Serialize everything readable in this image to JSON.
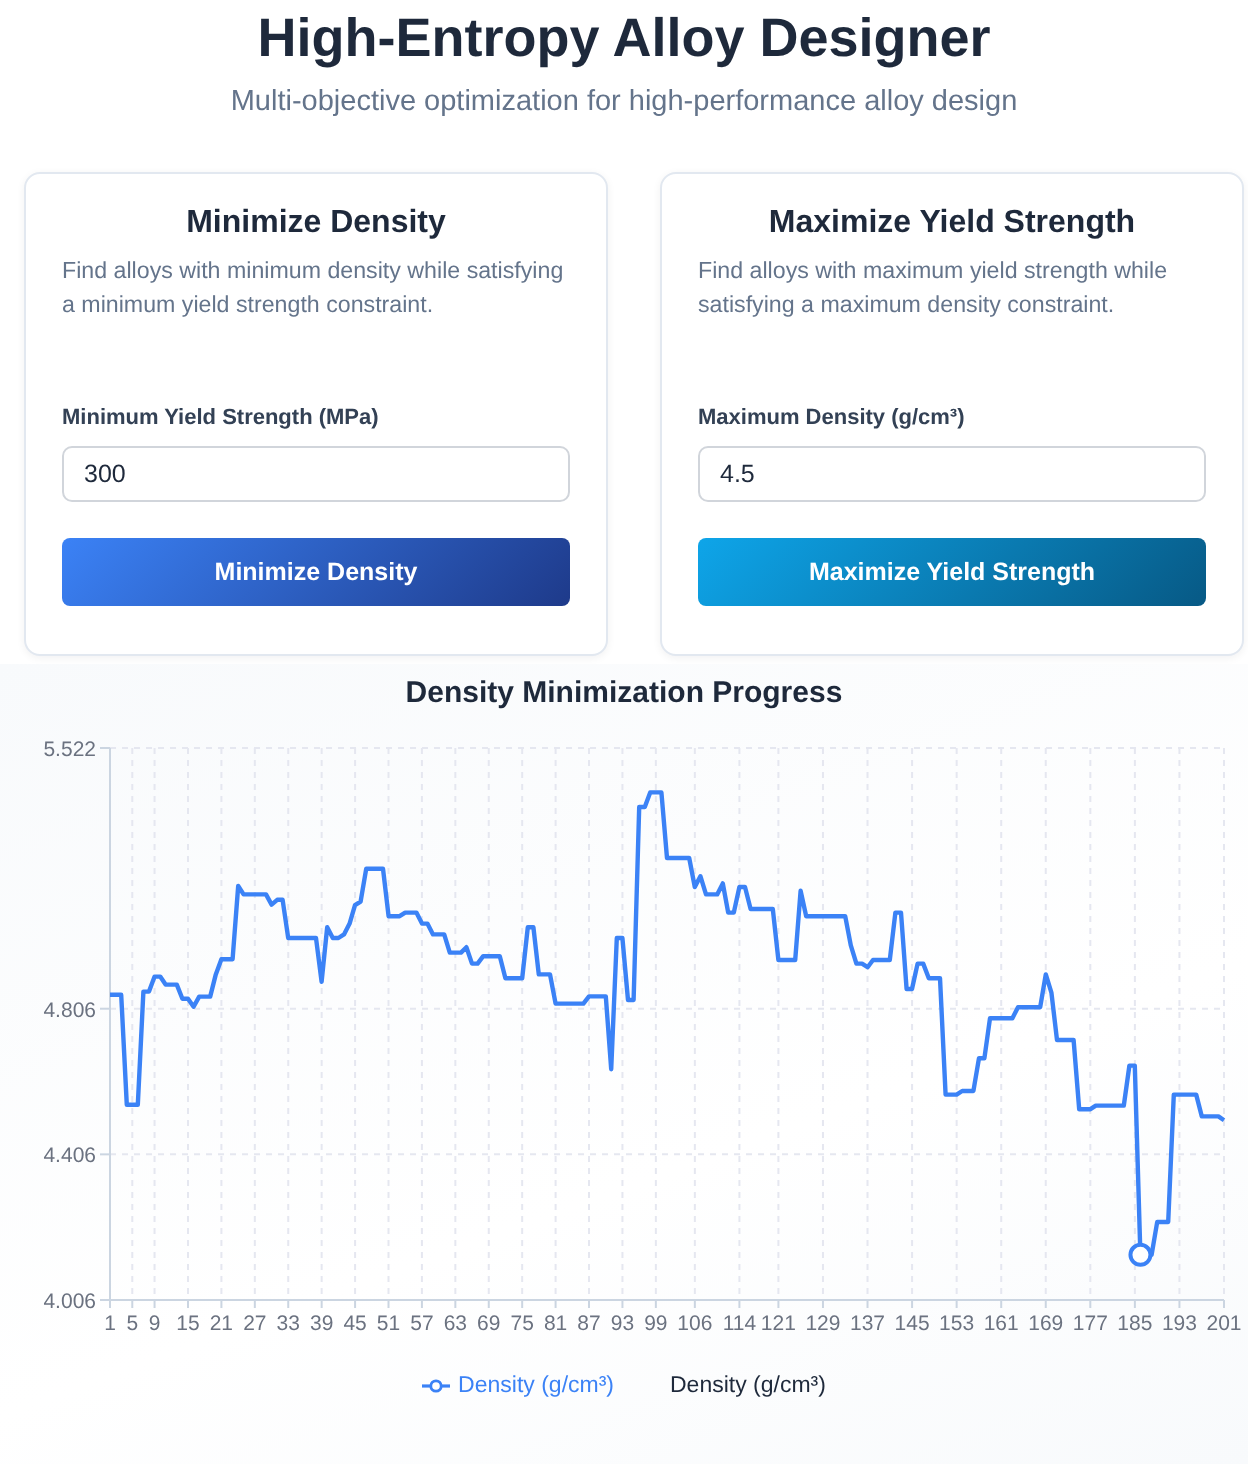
{
  "header": {
    "title": "High-Entropy Alloy Designer",
    "subtitle": "Multi-objective optimization for high-performance alloy design"
  },
  "cards": [
    {
      "title": "Minimize Density",
      "description": "Find alloys with minimum density while satisfying a minimum yield strength constraint.",
      "field_label": "Minimum Yield Strength (MPa)",
      "value": "300",
      "button": "Minimize Density",
      "kind": "blue"
    },
    {
      "title": "Maximize Yield Strength",
      "description": "Find alloys with maximum yield strength while satisfying a maximum density constraint.",
      "field_label": "Maximum Density (g/cm³)",
      "value": "4.5",
      "button": "Maximize Yield Strength",
      "kind": "cyan"
    }
  ],
  "chart": {
    "title": "Density Minimization Progress",
    "chart_data": {
      "type": "line",
      "ylabel": "Density (g/cm³)",
      "grid": true,
      "xlim": [
        1,
        201
      ],
      "ylim": [
        4.006,
        5.522
      ],
      "x": [
        1,
        2,
        3,
        4,
        5,
        6,
        7,
        8,
        9,
        10,
        11,
        12,
        13,
        14,
        15,
        16,
        17,
        18,
        19,
        20,
        21,
        22,
        23,
        24,
        25,
        26,
        27,
        28,
        29,
        30,
        31,
        32,
        33,
        34,
        35,
        36,
        37,
        38,
        39,
        40,
        41,
        42,
        43,
        44,
        45,
        46,
        47,
        48,
        49,
        50,
        51,
        52,
        53,
        54,
        55,
        56,
        57,
        58,
        59,
        60,
        61,
        62,
        63,
        64,
        65,
        66,
        67,
        68,
        69,
        70,
        71,
        72,
        73,
        74,
        75,
        76,
        77,
        78,
        79,
        80,
        81,
        82,
        83,
        84,
        85,
        86,
        87,
        88,
        89,
        90,
        91,
        92,
        93,
        94,
        95,
        96,
        97,
        98,
        99,
        100,
        101,
        102,
        103,
        104,
        105,
        106,
        107,
        108,
        109,
        110,
        111,
        112,
        113,
        114,
        115,
        116,
        117,
        118,
        119,
        120,
        121,
        122,
        123,
        124,
        125,
        126,
        127,
        128,
        129,
        130,
        131,
        132,
        133,
        134,
        135,
        136,
        137,
        138,
        139,
        140,
        141,
        142,
        143,
        144,
        145,
        146,
        147,
        148,
        149,
        150,
        151,
        152,
        153,
        154,
        155,
        156,
        157,
        158,
        159,
        160,
        161,
        162,
        163,
        164,
        165,
        166,
        167,
        168,
        169,
        170,
        171,
        172,
        173,
        174,
        175,
        176,
        177,
        178,
        179,
        180,
        181,
        182,
        183,
        184,
        185,
        186,
        187,
        188,
        189,
        190,
        191,
        192,
        193,
        194,
        195,
        196,
        197,
        198,
        199,
        200,
        201
      ],
      "xticks": [
        1,
        5,
        9,
        15,
        21,
        27,
        33,
        39,
        45,
        51,
        57,
        63,
        69,
        75,
        81,
        87,
        93,
        99,
        106,
        114,
        121,
        129,
        137,
        145,
        153,
        161,
        169,
        177,
        185,
        193,
        201
      ],
      "yticks": [
        {
          "value": 4.006,
          "label": "4.006"
        },
        {
          "value": 4.406,
          "label": "4.406"
        },
        {
          "value": 4.806,
          "label": "4.806"
        },
        {
          "value": 5.522,
          "label": "5.522"
        }
      ],
      "series": [
        {
          "name": "Density (g/cm³)",
          "color": "#3b82f6",
          "values": [
            4.844,
            4.844,
            4.844,
            4.542,
            4.542,
            4.542,
            4.853,
            4.853,
            4.894,
            4.894,
            4.872,
            4.872,
            4.872,
            4.833,
            4.833,
            4.811,
            4.839,
            4.839,
            4.839,
            4.9,
            4.942,
            4.942,
            4.942,
            5.143,
            5.12,
            5.12,
            5.12,
            5.12,
            5.12,
            5.092,
            5.105,
            5.105,
            5.0,
            5.0,
            5.0,
            5.0,
            5.0,
            5.0,
            4.88,
            5.03,
            5.0,
            5.0,
            5.01,
            5.04,
            5.09,
            5.1,
            5.19,
            5.19,
            5.19,
            5.19,
            5.06,
            5.06,
            5.06,
            5.07,
            5.07,
            5.07,
            5.04,
            5.04,
            5.01,
            5.01,
            5.01,
            4.96,
            4.96,
            4.96,
            4.975,
            4.93,
            4.93,
            4.95,
            4.95,
            4.95,
            4.95,
            4.89,
            4.89,
            4.89,
            4.89,
            5.03,
            5.03,
            4.9,
            4.9,
            4.9,
            4.82,
            4.82,
            4.82,
            4.82,
            4.82,
            4.82,
            4.84,
            4.84,
            4.84,
            4.84,
            4.64,
            5.0,
            5.0,
            4.83,
            4.83,
            5.36,
            5.36,
            5.4,
            5.4,
            5.4,
            5.22,
            5.22,
            5.22,
            5.22,
            5.22,
            5.14,
            5.17,
            5.12,
            5.12,
            5.12,
            5.15,
            5.07,
            5.07,
            5.14,
            5.14,
            5.08,
            5.08,
            5.08,
            5.08,
            5.08,
            4.94,
            4.94,
            4.94,
            4.94,
            5.13,
            5.06,
            5.06,
            5.06,
            5.06,
            5.06,
            5.06,
            5.06,
            5.06,
            4.98,
            4.93,
            4.93,
            4.92,
            4.94,
            4.94,
            4.94,
            4.94,
            5.07,
            5.07,
            4.86,
            4.86,
            4.93,
            4.93,
            4.89,
            4.89,
            4.89,
            4.57,
            4.57,
            4.57,
            4.58,
            4.58,
            4.58,
            4.67,
            4.67,
            4.78,
            4.78,
            4.78,
            4.78,
            4.78,
            4.81,
            4.81,
            4.81,
            4.81,
            4.81,
            4.9,
            4.85,
            4.72,
            4.72,
            4.72,
            4.72,
            4.53,
            4.53,
            4.53,
            4.54,
            4.54,
            4.54,
            4.54,
            4.54,
            4.54,
            4.65,
            4.65,
            4.13,
            4.13,
            4.13,
            4.22,
            4.22,
            4.22,
            4.57,
            4.57,
            4.57,
            4.57,
            4.57,
            4.51,
            4.51,
            4.51,
            4.51,
            4.5
          ]
        }
      ]
    }
  }
}
